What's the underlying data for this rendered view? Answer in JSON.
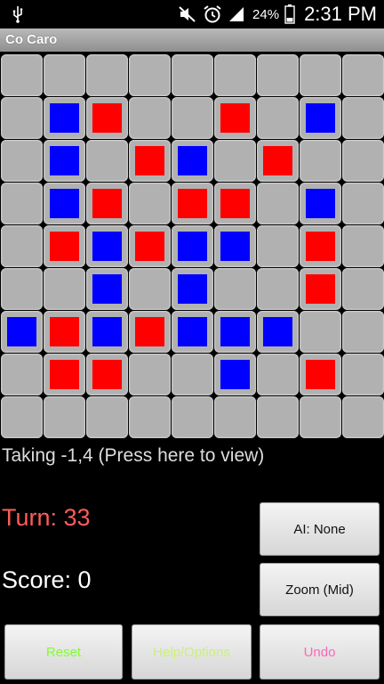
{
  "status": {
    "battery": "24%",
    "time": "2:31 PM",
    "icons": [
      "usb-icon",
      "mute-icon",
      "alarm-icon",
      "signal-icon",
      "battery-icon"
    ]
  },
  "app": {
    "title": "Co Caro"
  },
  "board": {
    "rows": 9,
    "cols": 9,
    "stones": [
      {
        "r": 1,
        "c": 1,
        "color": "blue"
      },
      {
        "r": 1,
        "c": 2,
        "color": "red"
      },
      {
        "r": 1,
        "c": 5,
        "color": "red"
      },
      {
        "r": 1,
        "c": 7,
        "color": "blue"
      },
      {
        "r": 2,
        "c": 1,
        "color": "blue"
      },
      {
        "r": 2,
        "c": 3,
        "color": "red"
      },
      {
        "r": 2,
        "c": 4,
        "color": "blue"
      },
      {
        "r": 2,
        "c": 6,
        "color": "red"
      },
      {
        "r": 3,
        "c": 1,
        "color": "blue"
      },
      {
        "r": 3,
        "c": 2,
        "color": "red"
      },
      {
        "r": 3,
        "c": 4,
        "color": "red"
      },
      {
        "r": 3,
        "c": 5,
        "color": "red"
      },
      {
        "r": 3,
        "c": 7,
        "color": "blue"
      },
      {
        "r": 4,
        "c": 1,
        "color": "red"
      },
      {
        "r": 4,
        "c": 2,
        "color": "blue"
      },
      {
        "r": 4,
        "c": 3,
        "color": "red"
      },
      {
        "r": 4,
        "c": 4,
        "color": "blue"
      },
      {
        "r": 4,
        "c": 5,
        "color": "blue"
      },
      {
        "r": 4,
        "c": 7,
        "color": "red"
      },
      {
        "r": 5,
        "c": 2,
        "color": "blue"
      },
      {
        "r": 5,
        "c": 4,
        "color": "blue"
      },
      {
        "r": 5,
        "c": 7,
        "color": "red"
      },
      {
        "r": 6,
        "c": 0,
        "color": "blue"
      },
      {
        "r": 6,
        "c": 1,
        "color": "red"
      },
      {
        "r": 6,
        "c": 2,
        "color": "blue"
      },
      {
        "r": 6,
        "c": 3,
        "color": "red"
      },
      {
        "r": 6,
        "c": 4,
        "color": "blue"
      },
      {
        "r": 6,
        "c": 5,
        "color": "blue"
      },
      {
        "r": 6,
        "c": 6,
        "color": "blue"
      },
      {
        "r": 7,
        "c": 1,
        "color": "red"
      },
      {
        "r": 7,
        "c": 2,
        "color": "red"
      },
      {
        "r": 7,
        "c": 5,
        "color": "blue"
      },
      {
        "r": 7,
        "c": 7,
        "color": "red"
      }
    ]
  },
  "info": {
    "taking": "Taking -1,4 (Press here to view)",
    "turn": "Turn: 33",
    "score": "Score: 0"
  },
  "buttons": {
    "ai": "AI: None",
    "zoom": "Zoom (Mid)",
    "reset": "Reset",
    "help": "Help/Options",
    "undo": "Undo"
  },
  "colors": {
    "reset_text": "#7fff2a",
    "help_text": "#c9f07a",
    "undo_text": "#ff66bb",
    "turn_text": "#ff5b5b"
  }
}
